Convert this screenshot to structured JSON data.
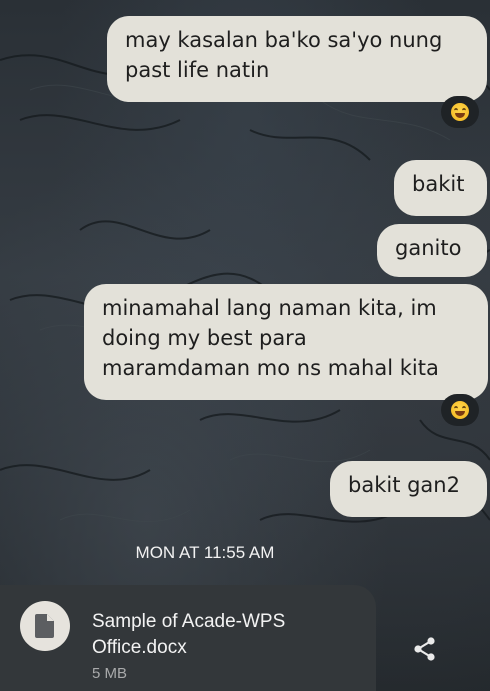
{
  "messages": [
    {
      "text": "may kasalan ba'ko sa'yo nung\npast life natin",
      "reaction": "grinning-squinting-face-emoji"
    },
    {
      "text": "bakit"
    },
    {
      "text": "ganito"
    },
    {
      "text": "minamahal lang naman kita, im\ndoing my best para\nmaramdaman mo ns mahal kita",
      "reaction": "grinning-squinting-face-emoji"
    },
    {
      "text": "bakit gan2"
    }
  ],
  "timestamp": "MON AT 11:55 AM",
  "attachment": {
    "name": "Sample of Acade-WPS Office.docx",
    "size": "5 MB",
    "icon": "document-icon"
  },
  "share": {
    "icon": "share-icon"
  },
  "colors": {
    "bubble": "#e3e1d9",
    "bubble_text": "#1e1e1e",
    "file_card": "#33373a",
    "reaction_bg": "#1f2326"
  }
}
